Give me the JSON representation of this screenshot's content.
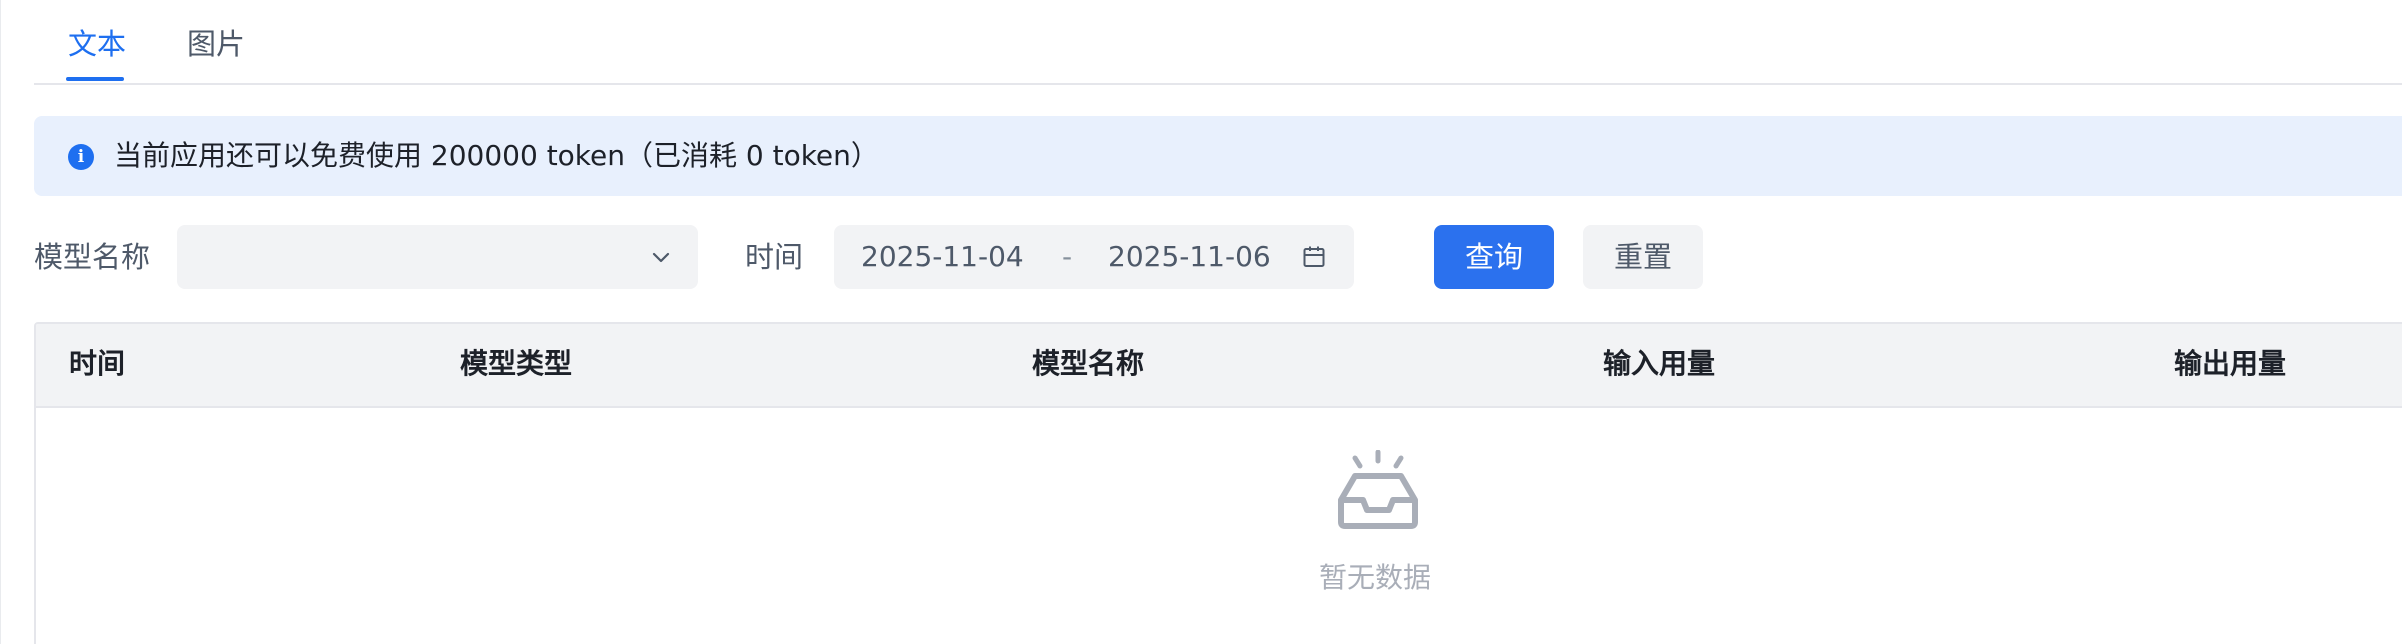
{
  "tabs": [
    {
      "label": "文本",
      "active": true
    },
    {
      "label": "图片",
      "active": false
    }
  ],
  "alert": {
    "icon": "info-icon",
    "icon_glyph": "i",
    "text": "当前应用还可以免费使用 200000 token（已消耗 0 token）"
  },
  "filters": {
    "model_name_label": "模型名称",
    "model_name_value": "",
    "time_label": "时间",
    "date_start": "2025-11-04",
    "date_separator": "-",
    "date_end": "2025-11-06",
    "query_button": "查询",
    "reset_button": "重置"
  },
  "table": {
    "columns": [
      "时间",
      "模型类型",
      "模型名称",
      "输入用量",
      "输出用量"
    ],
    "rows": [],
    "empty_text": "暂无数据"
  },
  "colors": {
    "accent": "#1e6ff0",
    "primary_button": "#2b71ee",
    "alert_background": "#e8f0fd",
    "input_background": "#f2f3f5",
    "empty_text": "#a9aeb8"
  }
}
